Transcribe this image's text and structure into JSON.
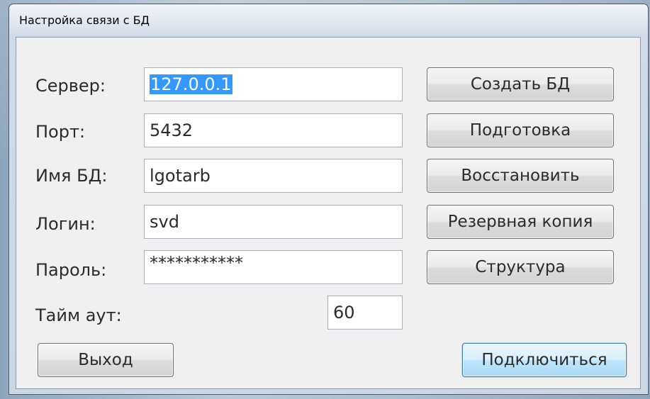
{
  "window": {
    "title": "Настройка связи с БД"
  },
  "form": {
    "server_label": "Сервер:",
    "server_value": "127.0.0.1",
    "port_label": "Порт:",
    "port_value": "5432",
    "dbname_label": "Имя БД:",
    "dbname_value": "lgotarb",
    "login_label": "Логин:",
    "login_value": "svd",
    "password_label": "Пароль:",
    "password_value": "***********",
    "timeout_label": "Тайм аут:",
    "timeout_value": "60"
  },
  "buttons": {
    "create_db": "Создать БД",
    "prepare": "Подготовка",
    "restore": "Восстановить",
    "backup": "Резервная копия",
    "structure": "Структура",
    "exit": "Выход",
    "connect": "Подключиться"
  },
  "colors": {
    "selection": "#3399ff",
    "default_button_border": "#3c7fb1"
  }
}
